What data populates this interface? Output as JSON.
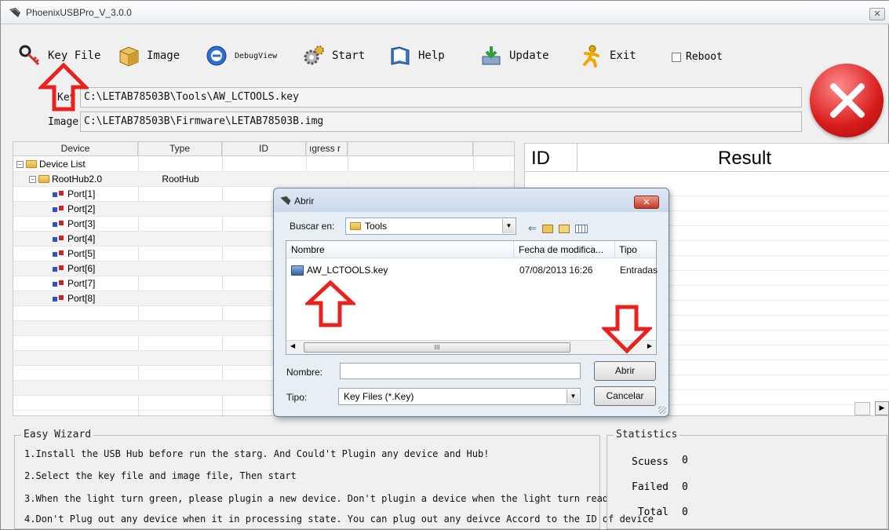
{
  "window": {
    "title": "PhoenixUSBPro_V_3.0.0",
    "close_glyph": "✕"
  },
  "toolbar": {
    "items": [
      {
        "label": "Key File",
        "icon": "key-icon"
      },
      {
        "label": "Image",
        "icon": "box-icon"
      },
      {
        "label": "DebugView",
        "icon": "debug-icon"
      },
      {
        "label": "Start",
        "icon": "gears-icon"
      },
      {
        "label": "Help",
        "icon": "book-icon"
      },
      {
        "label": "Update",
        "icon": "update-icon"
      },
      {
        "label": "Exit",
        "icon": "runner-icon"
      }
    ],
    "reboot_label": "Reboot"
  },
  "paths": {
    "key_label": "Key",
    "key_value": "C:\\LETAB78503B\\Tools\\AW_LCTOOLS.key",
    "image_label": "Image",
    "image_value": "C:\\LETAB78503B\\Firmware\\LETAB78503B.img"
  },
  "device_table": {
    "columns": [
      "Device",
      "Type",
      "ID",
      "ıgress r"
    ],
    "rows": [
      {
        "name": "Device List",
        "type": ""
      },
      {
        "name": "RootHub2.0",
        "type": "RootHub"
      },
      {
        "name": "Port[1]",
        "type": ""
      },
      {
        "name": "Port[2]",
        "type": ""
      },
      {
        "name": "Port[3]",
        "type": ""
      },
      {
        "name": "Port[4]",
        "type": ""
      },
      {
        "name": "Port[5]",
        "type": ""
      },
      {
        "name": "Port[6]",
        "type": ""
      },
      {
        "name": "Port[7]",
        "type": ""
      },
      {
        "name": "Port[8]",
        "type": ""
      }
    ]
  },
  "result_panel": {
    "col_id": "ID",
    "col_result": "Result"
  },
  "wizard": {
    "title": "Easy Wizard",
    "lines": [
      "1.Install the USB Hub before run the starg. And Could't Plugin any device and Hub!",
      "2.Select the key file and image file, Then start",
      "3.When the light turn green, please plugin a new device. Don't plugin a device when the light turn read",
      "4.Don't Plug out any device when it in processing state. You can plug out any deivce Accord to the ID of device"
    ]
  },
  "statistics": {
    "title": "Statistics",
    "success_label": "Scuess",
    "success_value": "0",
    "failed_label": "Failed",
    "failed_value": "0",
    "total_label": "Total",
    "total_value": "0"
  },
  "dialog": {
    "title": "Abrir",
    "close_glyph": "✕",
    "look_in_label": "Buscar en:",
    "look_in_value": "Tools",
    "columns": [
      "Nombre",
      "Fecha de modifica...",
      "Tipo"
    ],
    "files": [
      {
        "name": "AW_LCTOOLS.key",
        "date": "07/08/2013 16:26",
        "type": "Entradas"
      }
    ],
    "scroll_grip": "III",
    "name_label": "Nombre:",
    "name_value": "",
    "type_label": "Tipo:",
    "type_value": "Key Files (*.Key)",
    "open_button": "Abrir",
    "cancel_button": "Cancelar"
  },
  "colors": {
    "annotation_red": "#e8231f",
    "exit_red": "#d81b1b"
  }
}
